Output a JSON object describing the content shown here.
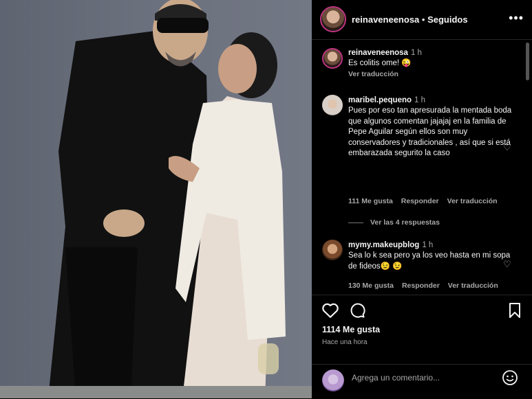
{
  "post": {
    "username": "reinaveneenosa",
    "separator": " • ",
    "follow_state": "Seguidos",
    "more_label": "•••"
  },
  "comments": [
    {
      "user": "reinaveneenosa",
      "time": "1 h",
      "text": "Es colitis ome! 😜",
      "translate": "Ver traducción"
    },
    {
      "user": "maribel.pequeno",
      "time": "1 h",
      "text": "Pues por eso tan apresurada la mentada boda que algunos comentan jajajaj en la familia de Pepe Aguilar según ellos son muy conservadores y tradicionales , así que si está embarazada segurito la caso",
      "likes": "111 Me gusta",
      "reply": "Responder",
      "translate": "Ver traducción",
      "replies_label": "Ver las 4 respuestas"
    },
    {
      "user": "mymy.makeupblog",
      "time": "1 h",
      "text": "Sea lo k sea pero ya los veo hasta en mi sopa de fideos😉 😉",
      "likes": "130 Me gusta",
      "reply": "Responder",
      "translate": "Ver traducción"
    }
  ],
  "actions": {
    "icons": [
      "heart-icon",
      "comment-icon",
      "bookmark-icon"
    ],
    "likes": "1114 Me gusta",
    "time_ago": "Hace una hora"
  },
  "add_comment": {
    "placeholder": "Agrega un comentario...",
    "emoji_icon": "smiley-icon"
  },
  "colors": {
    "background": "#000000",
    "muted": "#a8a8a8",
    "ring": "#c13584"
  }
}
